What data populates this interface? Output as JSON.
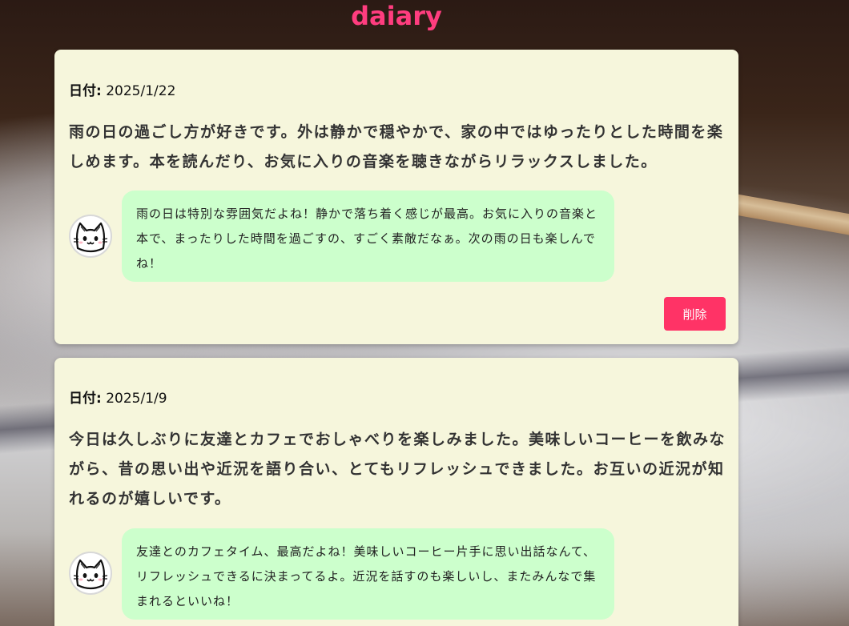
{
  "app": {
    "title": "daiary"
  },
  "entries": [
    {
      "date_label": "日付:",
      "date": "2025/1/22",
      "text": "雨の日の過ごし方が好きです。外は静かで穏やかで、家の中ではゆったりとした時間を楽しめます。本を読んだり、お気に入りの音楽を聴きながらリラックスしました。",
      "reply": "雨の日は特別な雰囲気だよね！静かで落ち着く感じが最高。お気に入りの音楽と本で、まったりした時間を過ごすの、すごく素敵だなぁ。次の雨の日も楽しんでね！",
      "avatar_icon": "cat-face-icon",
      "delete_label": "削除"
    },
    {
      "date_label": "日付:",
      "date": "2025/1/9",
      "text": "今日は久しぶりに友達とカフェでおしゃべりを楽しみました。美味しいコーヒーを飲みながら、昔の思い出や近況を語り合い、とてもリフレッシュできました。お互いの近況が知れるのが嬉しいです。",
      "reply": "友達とのカフェタイム、最高だよね！美味しいコーヒー片手に思い出話なんて、リフレッシュできるに決まってるよ。近況を話すのも楽しいし、またみんなで集まれるといいね！",
      "avatar_icon": "cat-face-icon"
    }
  ],
  "colors": {
    "title": "#ff3d7f",
    "card_bg": "#f6f6dc",
    "bubble_bg": "#ccffcc",
    "delete_bg": "#ff3366"
  }
}
